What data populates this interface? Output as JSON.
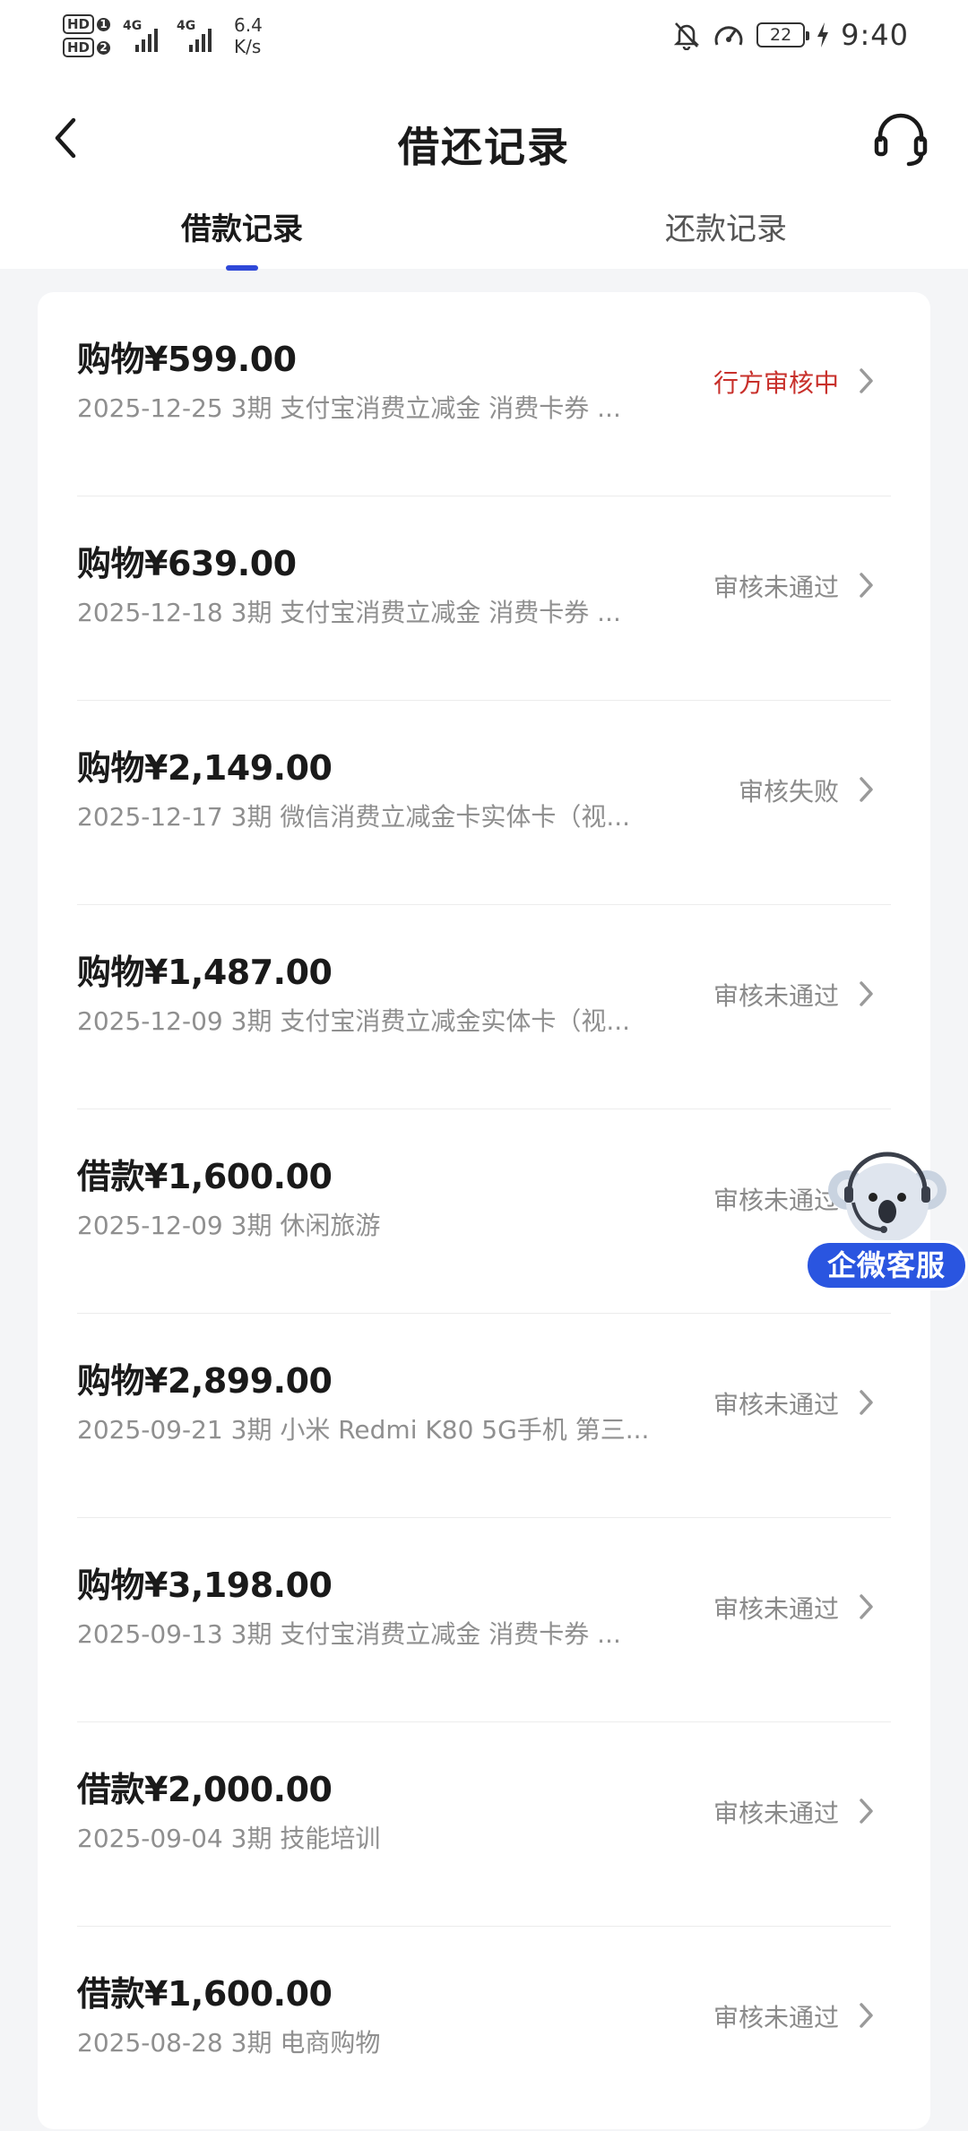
{
  "status_bar": {
    "sim1": "HD",
    "sim1_index": "1",
    "sim2": "HD",
    "sim2_index": "2",
    "net1": "4G",
    "net2": "4G",
    "speed_value": "6.4",
    "speed_unit": "K/s",
    "battery": "22",
    "time": "9:40",
    "icons": [
      "bell-muted-icon",
      "speedometer-icon",
      "battery-icon",
      "charging-icon"
    ]
  },
  "header": {
    "title": "借还记录",
    "back_icon": "chevron-left-icon",
    "service_icon": "headset-icon"
  },
  "tabs": [
    {
      "label": "借款记录",
      "active": true
    },
    {
      "label": "还款记录",
      "active": false
    }
  ],
  "records": [
    {
      "amount": "购物¥599.00",
      "desc": "2025-12-25 3期  支付宝消费立减金 消费卡券 ...",
      "status": "行方审核中"
    },
    {
      "amount": "购物¥639.00",
      "desc": "2025-12-18 3期  支付宝消费立减金 消费卡券 ...",
      "status": "审核未通过"
    },
    {
      "amount": "购物¥2,149.00",
      "desc": "2025-12-17 3期  微信消费立减金卡实体卡（视...",
      "status": "审核失败"
    },
    {
      "amount": "购物¥1,487.00",
      "desc": "2025-12-09 3期  支付宝消费立减金实体卡（视...",
      "status": "审核未通过"
    },
    {
      "amount": "借款¥1,600.00",
      "desc": "2025-12-09 3期  休闲旅游",
      "status": "审核未通过"
    },
    {
      "amount": "购物¥2,899.00",
      "desc": "2025-09-21 3期  小米 Redmi K80 5G手机 第三...",
      "status": "审核未通过"
    },
    {
      "amount": "购物¥3,198.00",
      "desc": "2025-09-13 3期  支付宝消费立减金 消费卡券 ...",
      "status": "审核未通过"
    },
    {
      "amount": "借款¥2,000.00",
      "desc": "2025-09-04 3期  技能培训",
      "status": "审核未通过"
    },
    {
      "amount": "借款¥1,600.00",
      "desc": "2025-08-28 3期  电商购物",
      "status": "审核未通过"
    }
  ],
  "floating_service": {
    "label": "企微客服",
    "icon": "koala-mascot-icon"
  },
  "colors": {
    "accent": "#2f48d8",
    "pending_status": "#c8302b",
    "muted_text": "#8f8f8f",
    "float_button": "#2a55e0"
  }
}
